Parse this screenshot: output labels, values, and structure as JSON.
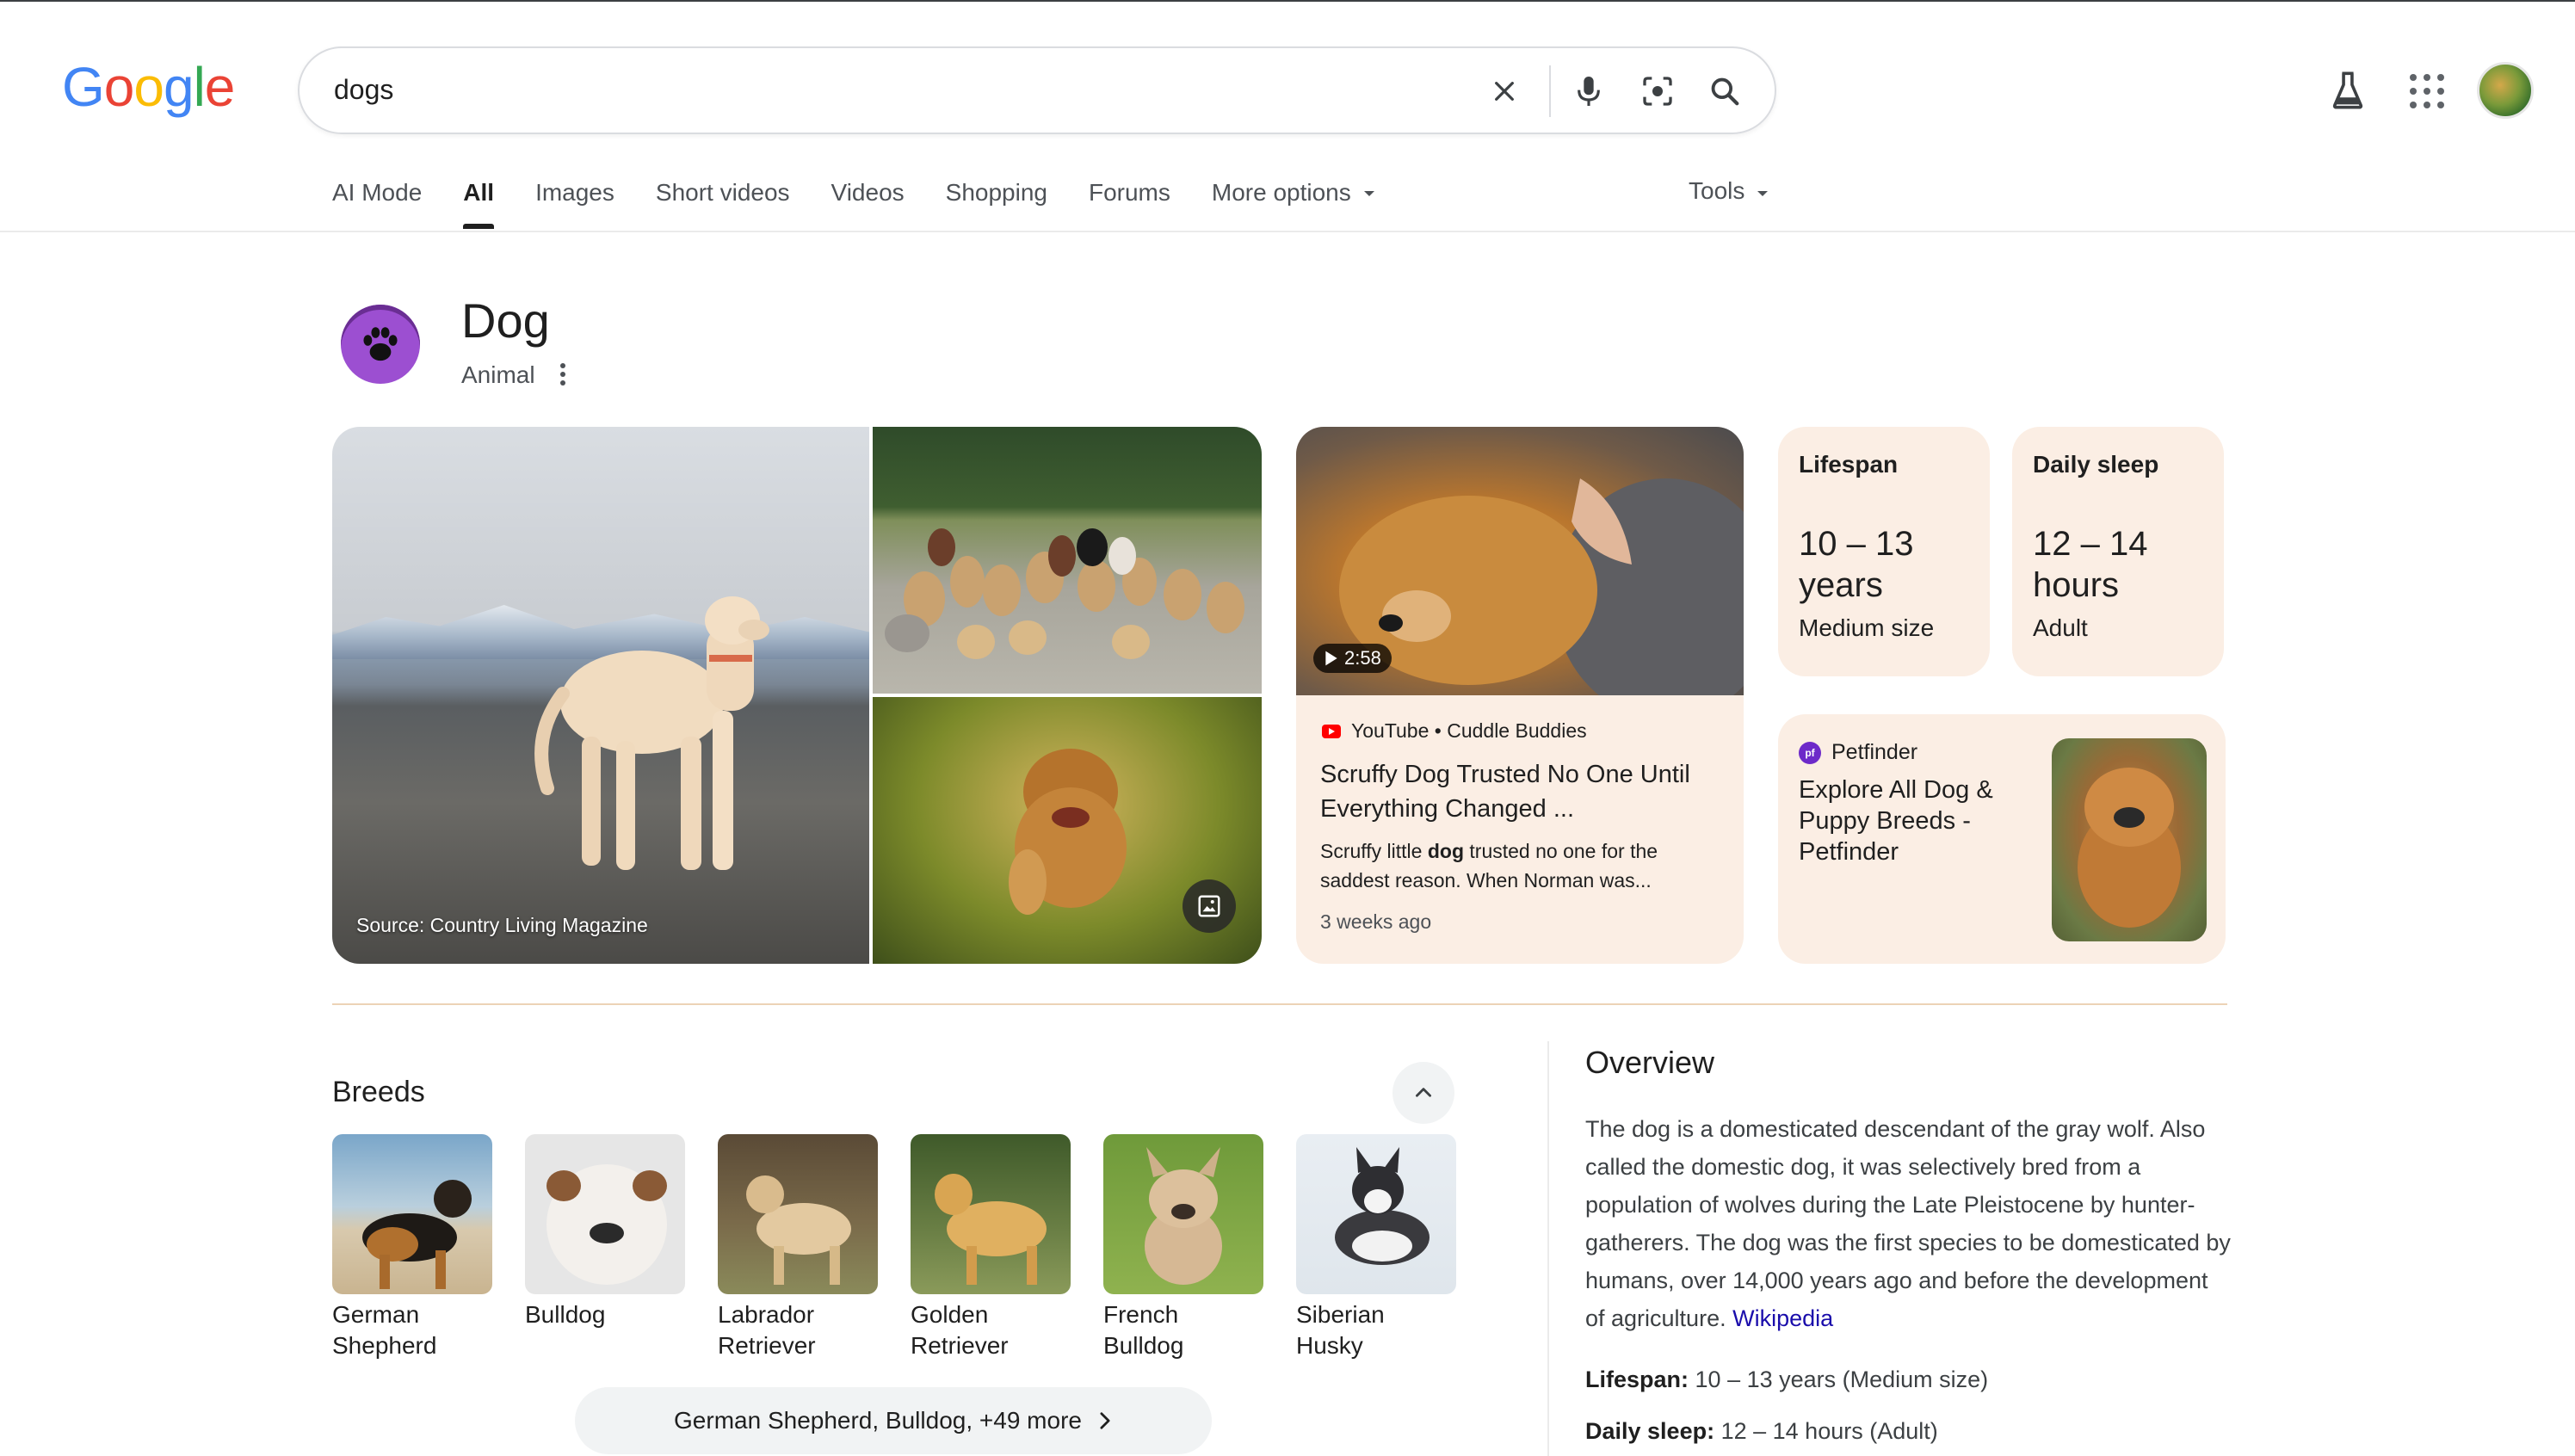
{
  "search": {
    "query": "dogs"
  },
  "tabs": [
    "AI Mode",
    "All",
    "Images",
    "Short videos",
    "Videos",
    "Shopping",
    "Forums",
    "More options"
  ],
  "tools_label": "Tools",
  "entity": {
    "title": "Dog",
    "subtitle": "Animal"
  },
  "images": {
    "source": "Source: Country Living Magazine"
  },
  "video": {
    "duration": "2:58",
    "channel": "YouTube • Cuddle Buddies",
    "title": "Scruffy Dog Trusted No One Until Everything Changed ...",
    "snippet_before": "Scruffy little ",
    "snippet_bold": "dog",
    "snippet_after": " trusted no one for the saddest reason. When Norman was...",
    "age": "3 weeks ago"
  },
  "stats": [
    {
      "label": "Lifespan",
      "value": "10 – 13 years",
      "sub": "Medium size"
    },
    {
      "label": "Daily sleep",
      "value": "12 – 14 hours",
      "sub": "Adult"
    }
  ],
  "petfinder": {
    "source": "Petfinder",
    "title": "Explore All Dog & Puppy Breeds - Petfinder"
  },
  "breeds": {
    "title": "Breeds",
    "items": [
      {
        "name": "German Shepherd"
      },
      {
        "name": "Bulldog"
      },
      {
        "name": "Labrador Retriever"
      },
      {
        "name": "Golden Retriever"
      },
      {
        "name": "French Bulldog"
      },
      {
        "name": "Siberian Husky"
      }
    ],
    "more_label": "German Shepherd, Bulldog, +49 more"
  },
  "overview": {
    "title": "Overview",
    "text": "The dog is a domesticated descendant of the gray wolf. Also called the domestic dog, it was selectively bred from a population of wolves during the Late Pleistocene by hunter-gatherers. The dog was the first species to be domesticated by humans, over 14,000 years ago and before the development of agriculture.",
    "link": "Wikipedia",
    "facts": [
      {
        "label": "Lifespan:",
        "value": "10 – 13 years (Medium size)"
      },
      {
        "label": "Daily sleep:",
        "value": "12 – 14 hours (Adult)"
      }
    ]
  },
  "colors": {
    "accent_card": "#fbeee4",
    "link": "#1a0dab",
    "divider": "#ecd3b6"
  }
}
